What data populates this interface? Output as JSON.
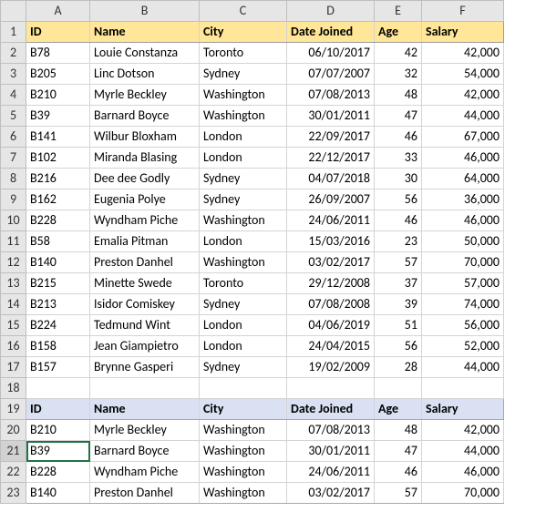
{
  "columns": [
    "A",
    "B",
    "C",
    "D",
    "E",
    "F"
  ],
  "headers": [
    "ID",
    "Name",
    "City",
    "Date Joined",
    "Age",
    "Salary"
  ],
  "table1": [
    {
      "id": "B78",
      "name": "Louie Constanza",
      "city": "Toronto",
      "date": "06/10/2017",
      "age": 42,
      "salary": "42,000"
    },
    {
      "id": "B205",
      "name": "Linc Dotson",
      "city": "Sydney",
      "date": "07/07/2007",
      "age": 32,
      "salary": "54,000"
    },
    {
      "id": "B210",
      "name": "Myrle Beckley",
      "city": "Washington",
      "date": "07/08/2013",
      "age": 48,
      "salary": "42,000"
    },
    {
      "id": "B39",
      "name": "Barnard Boyce",
      "city": "Washington",
      "date": "30/01/2011",
      "age": 47,
      "salary": "44,000"
    },
    {
      "id": "B141",
      "name": "Wilbur Bloxham",
      "city": "London",
      "date": "22/09/2017",
      "age": 46,
      "salary": "67,000"
    },
    {
      "id": "B102",
      "name": "Miranda Blasing",
      "city": "London",
      "date": "22/12/2017",
      "age": 33,
      "salary": "46,000"
    },
    {
      "id": "B216",
      "name": "Dee dee Godly",
      "city": "Sydney",
      "date": "04/07/2018",
      "age": 30,
      "salary": "64,000"
    },
    {
      "id": "B162",
      "name": "Eugenia Polye",
      "city": "Sydney",
      "date": "26/09/2007",
      "age": 56,
      "salary": "36,000"
    },
    {
      "id": "B228",
      "name": "Wyndham Piche",
      "city": "Washington",
      "date": "24/06/2011",
      "age": 46,
      "salary": "46,000"
    },
    {
      "id": "B58",
      "name": "Emalia Pitman",
      "city": "London",
      "date": "15/03/2016",
      "age": 23,
      "salary": "50,000"
    },
    {
      "id": "B140",
      "name": "Preston Danhel",
      "city": "Washington",
      "date": "03/02/2017",
      "age": 57,
      "salary": "70,000"
    },
    {
      "id": "B215",
      "name": "Minette Swede",
      "city": "Toronto",
      "date": "29/12/2008",
      "age": 37,
      "salary": "57,000"
    },
    {
      "id": "B213",
      "name": "Isidor Comiskey",
      "city": "Sydney",
      "date": "07/08/2008",
      "age": 39,
      "salary": "74,000"
    },
    {
      "id": "B224",
      "name": "Tedmund Wint",
      "city": "London",
      "date": "04/06/2019",
      "age": 51,
      "salary": "56,000"
    },
    {
      "id": "B158",
      "name": "Jean Giampietro",
      "city": "London",
      "date": "24/04/2015",
      "age": 56,
      "salary": "52,000"
    },
    {
      "id": "B157",
      "name": "Brynne Gasperi",
      "city": "Sydney",
      "date": "19/02/2009",
      "age": 28,
      "salary": "44,000"
    }
  ],
  "table2": [
    {
      "id": "B210",
      "name": "Myrle Beckley",
      "city": "Washington",
      "date": "07/08/2013",
      "age": 48,
      "salary": "42,000"
    },
    {
      "id": "B39",
      "name": "Barnard Boyce",
      "city": "Washington",
      "date": "30/01/2011",
      "age": 47,
      "salary": "44,000"
    },
    {
      "id": "B228",
      "name": "Wyndham Piche",
      "city": "Washington",
      "date": "24/06/2011",
      "age": 46,
      "salary": "46,000"
    },
    {
      "id": "B140",
      "name": "Preston Danhel",
      "city": "Washington",
      "date": "03/02/2017",
      "age": 57,
      "salary": "70,000"
    }
  ],
  "selected_cell": "A21"
}
